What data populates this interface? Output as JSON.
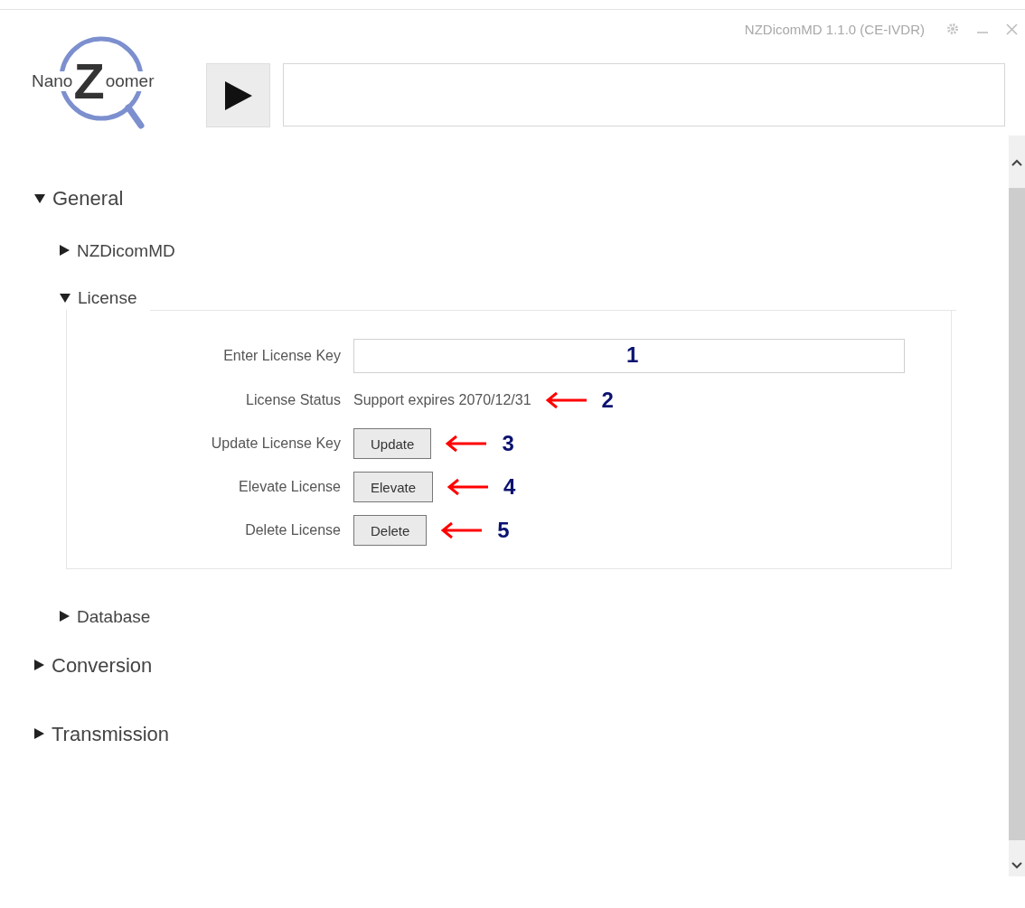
{
  "title_bar": {
    "title": "NZDicomMD 1.1.0 (CE-IVDR)"
  },
  "logo": {
    "left": "Nano",
    "mid": "Z",
    "right": "oomer"
  },
  "sections": [
    {
      "label": "General",
      "expanded": true,
      "children": [
        {
          "label": "NZDicomMD",
          "expanded": false
        },
        {
          "label": "License",
          "expanded": true,
          "rows": [
            {
              "kind": "field",
              "label": "Enter License Key",
              "callout": "1",
              "arrow": false
            },
            {
              "kind": "text",
              "label": "License Status",
              "value": "Support expires 2070/12/31",
              "callout": "2",
              "arrow": true
            },
            {
              "kind": "button",
              "label": "Update License Key",
              "button": "Update",
              "callout": "3",
              "arrow": true
            },
            {
              "kind": "button",
              "label": "Elevate License",
              "button": "Elevate",
              "callout": "4",
              "arrow": true
            },
            {
              "kind": "button",
              "label": "Delete License",
              "button": "Delete",
              "callout": "5",
              "arrow": true
            }
          ]
        },
        {
          "label": "Database",
          "expanded": false
        }
      ]
    },
    {
      "label": "Conversion",
      "expanded": false
    },
    {
      "label": "Transmission",
      "expanded": false
    }
  ]
}
